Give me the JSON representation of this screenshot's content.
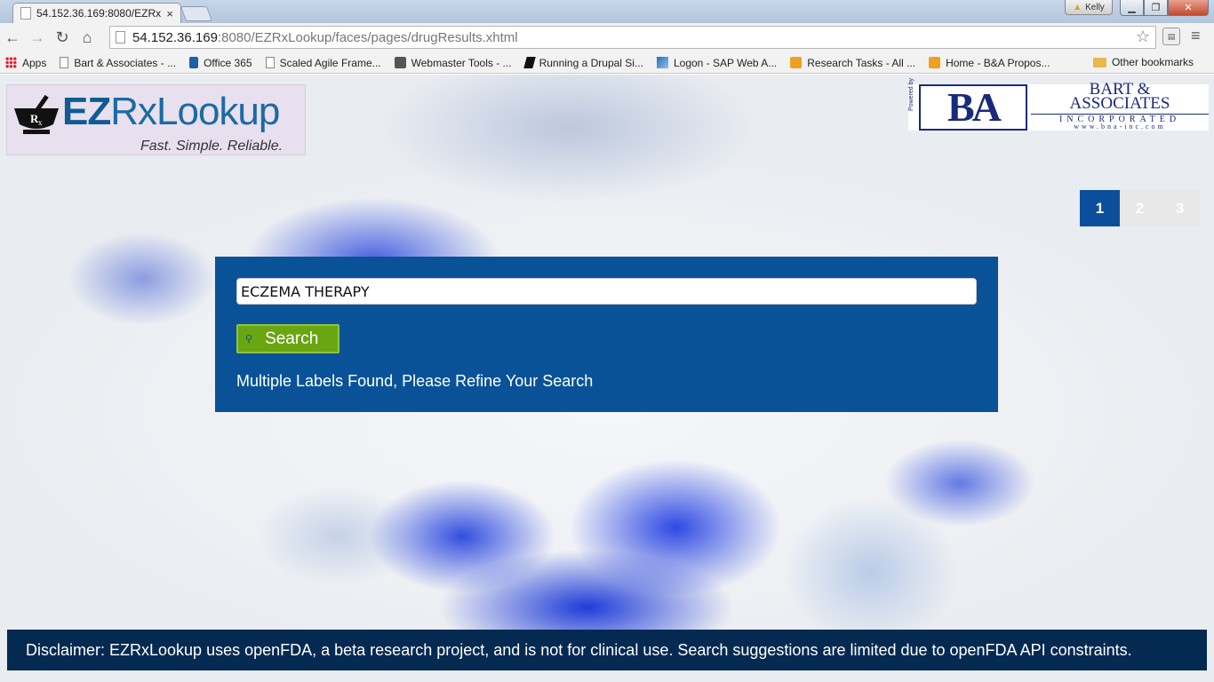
{
  "browser": {
    "tab_title": "54.152.36.169:8080/EZRxL",
    "tab_close": "×",
    "user_name": "Kelly",
    "url_host": "54.152.36.169",
    "url_path": ":8080/EZRxLookup/faces/pages/drugResults.xhtml",
    "bookmarks": [
      {
        "label": "Apps",
        "icon": "apps-grid-icon"
      },
      {
        "label": "Bart & Associates - ...",
        "icon": "page-icon"
      },
      {
        "label": "Office 365",
        "icon": "office-icon"
      },
      {
        "label": "Scaled Agile Frame...",
        "icon": "page-icon"
      },
      {
        "label": "Webmaster Tools - ...",
        "icon": "webmaster-icon"
      },
      {
        "label": "Running a Drupal Si...",
        "icon": "drupal-icon"
      },
      {
        "label": "Logon - SAP Web A...",
        "icon": "sap-icon"
      },
      {
        "label": "Research Tasks - All ...",
        "icon": "tasks-icon"
      },
      {
        "label": "Home - B&A Propos...",
        "icon": "tasks-icon"
      }
    ],
    "other_bookmarks": "Other bookmarks"
  },
  "logo": {
    "ez": "EZ",
    "rx_lookup": "RxLookup",
    "tagline": "Fast. Simple. Reliable."
  },
  "partner": {
    "powered": "Powered by",
    "mark": "BA",
    "name_line1": "BART &",
    "name_line2": "ASSOCIATES",
    "inc": "INCORPORATED",
    "web": "www.bna-inc.com"
  },
  "pager": {
    "pages": [
      "1",
      "2",
      "3"
    ],
    "active": "1"
  },
  "search": {
    "query": "ECZEMA THERAPY",
    "button_label": "Search",
    "status": "Multiple Labels Found, Please Refine Your Search"
  },
  "footer": {
    "disclaimer": "Disclaimer: EZRxLookup uses openFDA, a beta research project, and is not for clinical use. Search suggestions are limited due to openFDA API constraints."
  },
  "colors": {
    "panel": "#0a5298",
    "button": "#6aa512",
    "pager_active": "#0b4f9c",
    "footer": "#052a52"
  }
}
